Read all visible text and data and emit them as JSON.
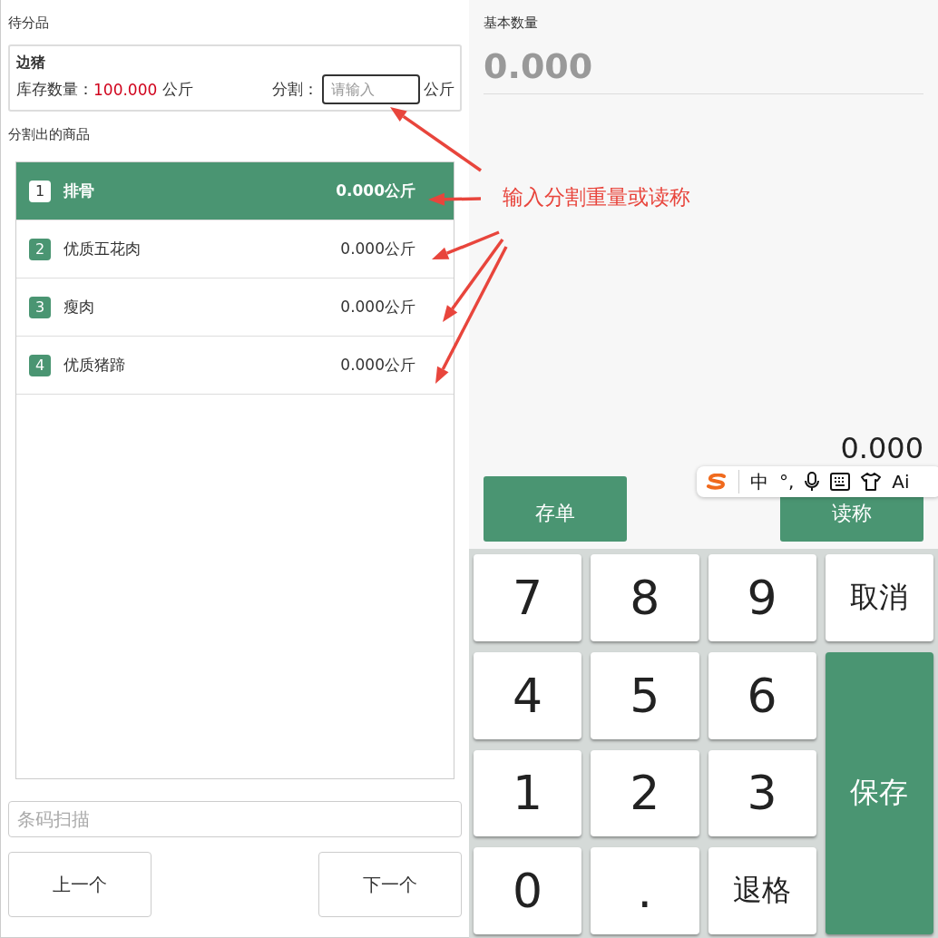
{
  "pending": {
    "title": "待分品",
    "name": "边猪",
    "stock_label": "库存数量：",
    "stock_value": "100.000",
    "stock_unit": "公斤",
    "split_label": "分割：",
    "split_placeholder": "请输入",
    "split_unit": "公斤"
  },
  "outputs": {
    "title": "分割出的商品",
    "items": [
      {
        "index": "1",
        "name": "排骨",
        "weight": "0.000公斤",
        "selected": true
      },
      {
        "index": "2",
        "name": "优质五花肉",
        "weight": "0.000公斤",
        "selected": false
      },
      {
        "index": "3",
        "name": "瘦肉",
        "weight": "0.000公斤",
        "selected": false
      },
      {
        "index": "4",
        "name": "优质猪蹄",
        "weight": "0.000公斤",
        "selected": false
      }
    ]
  },
  "barcode": {
    "placeholder": "条码扫描"
  },
  "nav_buttons": [
    "上一个",
    "下一个"
  ],
  "quantity": {
    "label": "基本数量",
    "value": "0.000",
    "reading": "0.000"
  },
  "actions": [
    "存单",
    "读称"
  ],
  "keypad": [
    {
      "label": "7",
      "kind": "key"
    },
    {
      "label": "8",
      "kind": "key"
    },
    {
      "label": "9",
      "kind": "key"
    },
    {
      "label": "取消",
      "kind": "key"
    },
    {
      "label": "4",
      "kind": "key"
    },
    {
      "label": "5",
      "kind": "key"
    },
    {
      "label": "6",
      "kind": "key"
    },
    {
      "label": "1",
      "kind": "key"
    },
    {
      "label": "2",
      "kind": "key"
    },
    {
      "label": "3",
      "kind": "key"
    },
    {
      "label": "0",
      "kind": "key"
    },
    {
      "label": ".",
      "kind": "key"
    },
    {
      "label": "退格",
      "kind": "key"
    },
    {
      "label": "保存",
      "kind": "primary"
    }
  ],
  "ime_toolbar": {
    "mode": "中",
    "punctuation": "°,",
    "ai": "Ai"
  },
  "annotation": {
    "text": "输入分割重量或读称"
  }
}
